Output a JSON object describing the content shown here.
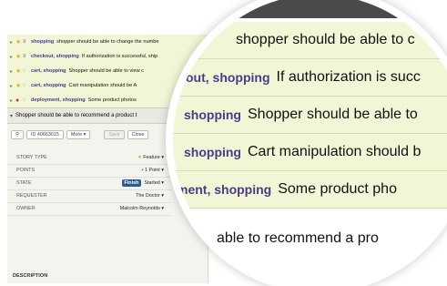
{
  "stories": [
    {
      "labels": "shopping",
      "title": "shopper should be able to change the numbe"
    },
    {
      "labels": "checkout, shopping",
      "title": "If authorization is successful, ship"
    },
    {
      "labels": "cart, shopping",
      "title": "Shopper should be able to view c"
    },
    {
      "labels": "cart, shopping",
      "title": "Cart manipulation should be A"
    },
    {
      "labels": "deployment, shopping",
      "title": "Some product photos"
    }
  ],
  "editor": {
    "title": "Shopper should be able to recommend a product t",
    "id_label": "ID",
    "id_value": "40663015",
    "more_label": "More",
    "save_label": "Save",
    "close_label": "Close",
    "fields": [
      {
        "key": "STORY TYPE",
        "value": "Feature"
      },
      {
        "key": "POINTS",
        "value": "1 Point"
      },
      {
        "key": "STATE",
        "value": "Started",
        "action": "Finish"
      },
      {
        "key": "REQUESTER",
        "value": "The Doctor"
      },
      {
        "key": "OWNER",
        "value": "Malcolm Reynolds"
      }
    ],
    "description_label": "DESCRIPTION"
  },
  "magnified": {
    "rows": [
      {
        "labels": "",
        "title": "shopper should be able to c"
      },
      {
        "labels": "out, shopping",
        "title": "If authorization is succ"
      },
      {
        "labels": "shopping",
        "title": "Shopper should be able to"
      },
      {
        "labels": "shopping",
        "title": "Cart manipulation should b"
      },
      {
        "labels": "ment, shopping",
        "title": "Some product pho"
      }
    ],
    "bottom_text": "able to recommend a pro"
  },
  "colors": {
    "row_bg": "#f3f6d6",
    "label": "#4a3a8a",
    "finish": "#2d5d8f"
  }
}
